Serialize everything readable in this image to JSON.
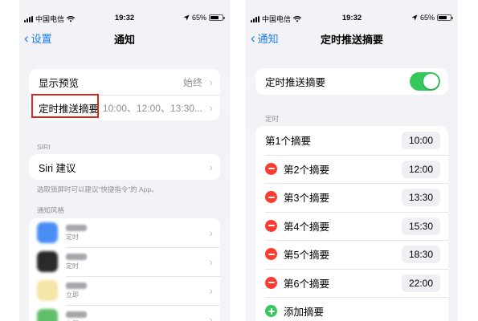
{
  "left": {
    "status": {
      "carrier": "中国电信",
      "time": "19:32",
      "battery": "65%"
    },
    "nav": {
      "back": "设置",
      "title": "通知"
    },
    "group1": [
      {
        "label": "显示预览",
        "value": "始终"
      },
      {
        "label": "定时推送摘要",
        "value": "10:00、12:00、13:30..."
      }
    ],
    "siri_label": "SIRI",
    "siri_row": "Siri 建议",
    "siri_note": "选取锁屏时可以建议“快捷指令”的 App。",
    "style_label": "通知风格",
    "apps": [
      {
        "sub": "定时"
      },
      {
        "sub": "定时"
      },
      {
        "sub": "立即"
      },
      {
        "sub": "立即"
      }
    ]
  },
  "right": {
    "status": {
      "carrier": "中国电信",
      "time": "19:32",
      "battery": "65%"
    },
    "nav": {
      "back": "通知",
      "title": "定时推送摘要"
    },
    "toggle_label": "定时推送摘要",
    "toggle_on": true,
    "section_label": "定时",
    "summaries": [
      {
        "label": "第1个摘要",
        "time": "10:00"
      },
      {
        "label": "第2个摘要",
        "time": "12:00"
      },
      {
        "label": "第3个摘要",
        "time": "13:30"
      },
      {
        "label": "第4个摘要",
        "time": "15:30"
      },
      {
        "label": "第5个摘要",
        "time": "18:30"
      },
      {
        "label": "第6个摘要",
        "time": "22:00"
      }
    ],
    "add_label": "添加摘要"
  },
  "colors": {
    "ios_blue": "#1a7cf6",
    "ios_green": "#34c759",
    "ios_red": "#ff3b30",
    "highlight_red": "#e0251a",
    "grouped_bg": "#f2f2f7"
  },
  "icons": [
    "chevron-left-icon",
    "chevron-right-icon",
    "signal-icon",
    "wifi-icon",
    "location-icon",
    "battery-icon",
    "minus-circle-icon",
    "plus-circle-icon"
  ]
}
